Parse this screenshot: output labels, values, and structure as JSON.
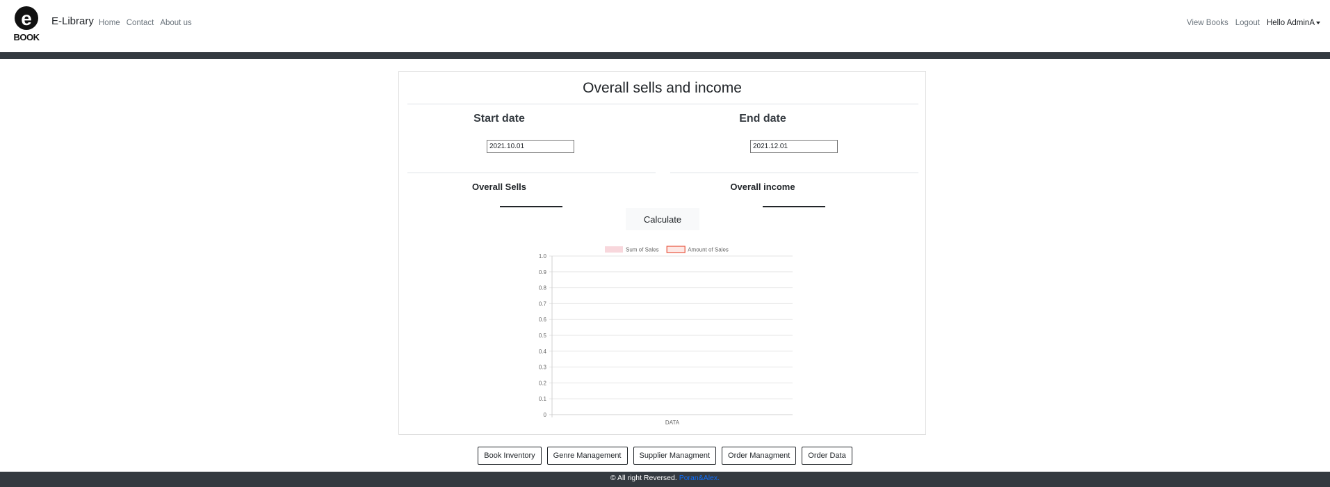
{
  "nav": {
    "brand": "E-Library",
    "logo_letter": "e",
    "logo_text": "BOOK",
    "links": [
      "Home",
      "Contact",
      "About us"
    ],
    "right": {
      "view_books": "View Books",
      "logout": "Logout",
      "user": "Hello AdminA"
    }
  },
  "card": {
    "title": "Overall sells and income",
    "start_label": "Start date",
    "end_label": "End date",
    "start_value": "2021.10.01",
    "end_value": "2021.12.01",
    "overall_sells": "Overall Sells",
    "overall_income": "Overall income",
    "calculate": "Calculate"
  },
  "chart_data": {
    "type": "bar",
    "categories": [
      "DATA"
    ],
    "series": [
      {
        "name": "Sum of Sales",
        "values": [],
        "color": "#f8d7dc"
      },
      {
        "name": "Amount of Sales",
        "values": [],
        "color": "#e8543e"
      }
    ],
    "ylim": [
      0,
      1
    ],
    "yticks": [
      "1.0",
      "0.9",
      "0.8",
      "0.7",
      "0.6",
      "0.5",
      "0.4",
      "0.3",
      "0.2",
      "0.1",
      "0"
    ],
    "grid": true,
    "legend": "top"
  },
  "buttons": [
    "Book Inventory",
    "Genre Management",
    "Supplier Managment",
    "Order Managment",
    "Order Data"
  ],
  "footer": {
    "text": "© All right Reversed.",
    "link": "Poran&Alex."
  },
  "colors": {
    "navbar_dark": "#343a40",
    "link_blue": "#0d6efd"
  }
}
